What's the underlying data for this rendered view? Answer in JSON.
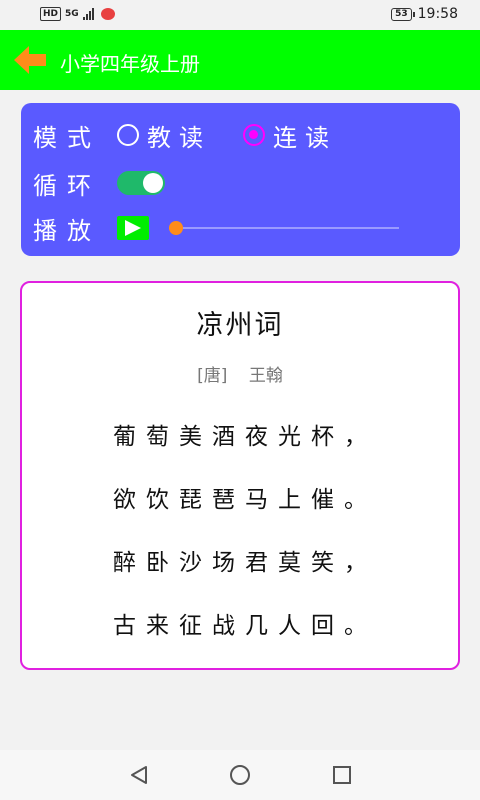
{
  "status_bar": {
    "network_badge": "HD",
    "signal_label": "5G",
    "battery": "53",
    "time": "19:58"
  },
  "header": {
    "title": "小学四年级上册",
    "back_icon": "back-arrow-icon"
  },
  "controls": {
    "mode_label": "模式",
    "mode_options": [
      {
        "label": "教读",
        "checked": false
      },
      {
        "label": "连读",
        "checked": true
      }
    ],
    "loop_label": "循环",
    "loop_on": true,
    "play_label": "播放",
    "play_progress": 0.0
  },
  "poem": {
    "title": "凉州词",
    "dynasty": "[唐]",
    "author": "王翰",
    "lines": [
      "葡萄美酒夜光杯，",
      "欲饮琵琶马上催。",
      "醉卧沙场君莫笑，",
      "古来征战几人回。"
    ]
  },
  "colors": {
    "header_bg": "#00ff00",
    "panel_bg": "#5a5aff",
    "radio_checked": "#ff00ff",
    "toggle_on": "#1fb96a",
    "play_button": "#00ee00",
    "slider_accent": "#ff8c1a",
    "card_border": "#e020e0"
  }
}
